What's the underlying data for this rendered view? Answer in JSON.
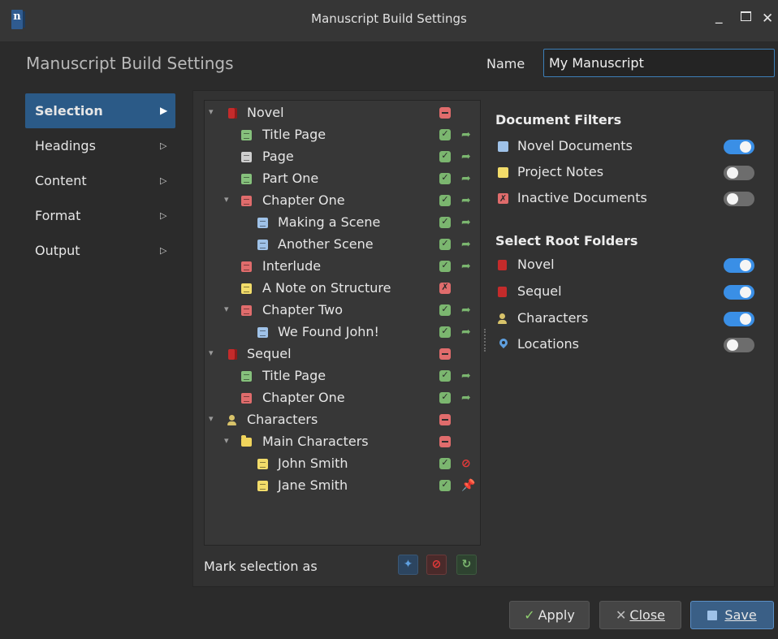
{
  "window": {
    "title": "Manuscript Build Settings",
    "app_icon_letter": "n",
    "minimize": "_",
    "close": "✕"
  },
  "header": {
    "title": "Manuscript Build Settings",
    "name_label": "Name",
    "name_value": "My Manuscript"
  },
  "nav": {
    "items": [
      {
        "label": "Selection",
        "active": true
      },
      {
        "label": "Headings",
        "active": false
      },
      {
        "label": "Content",
        "active": false
      },
      {
        "label": "Format",
        "active": false
      },
      {
        "label": "Output",
        "active": false
      }
    ]
  },
  "tree": [
    {
      "label": "Novel",
      "icon": "novel-root-icon",
      "expanded": true,
      "state": "partial"
    },
    {
      "label": "Title Page",
      "icon": "document-icon",
      "state": "included",
      "action": "go"
    },
    {
      "label": "Page",
      "icon": "document-icon",
      "state": "included",
      "action": "go"
    },
    {
      "label": "Part One",
      "icon": "document-icon",
      "state": "included",
      "action": "go"
    },
    {
      "label": "Chapter One",
      "icon": "document-icon",
      "expanded": true,
      "state": "included",
      "action": "go"
    },
    {
      "label": "Making a Scene",
      "icon": "document-icon",
      "state": "included",
      "action": "go"
    },
    {
      "label": "Another Scene",
      "icon": "document-icon",
      "state": "included",
      "action": "go"
    },
    {
      "label": "Interlude",
      "icon": "document-icon",
      "state": "included",
      "action": "go"
    },
    {
      "label": "A Note on Structure",
      "icon": "note-icon",
      "state": "excluded"
    },
    {
      "label": "Chapter Two",
      "icon": "document-icon",
      "expanded": true,
      "state": "included",
      "action": "go"
    },
    {
      "label": "We Found John!",
      "icon": "document-icon",
      "state": "included",
      "action": "go"
    },
    {
      "label": "Sequel",
      "icon": "novel-root-icon",
      "expanded": true,
      "state": "partial"
    },
    {
      "label": "Title Page",
      "icon": "document-icon",
      "state": "included",
      "action": "go"
    },
    {
      "label": "Chapter One",
      "icon": "document-icon",
      "state": "included",
      "action": "go"
    },
    {
      "label": "Characters",
      "icon": "person-icon",
      "expanded": true,
      "state": "partial"
    },
    {
      "label": "Main Characters",
      "icon": "folder-icon",
      "expanded": true,
      "state": "partial"
    },
    {
      "label": "John Smith",
      "icon": "note-icon",
      "state": "included",
      "action": "excluded"
    },
    {
      "label": "Jane Smith",
      "icon": "note-icon",
      "state": "included",
      "action": "pinned"
    }
  ],
  "mark_selection": {
    "label": "Mark selection as",
    "buttons": [
      "pin-icon",
      "exclude-icon",
      "reset-icon"
    ]
  },
  "document_filters": {
    "title": "Document Filters",
    "items": [
      {
        "label": "Novel Documents",
        "on": true
      },
      {
        "label": "Project Notes",
        "on": false
      },
      {
        "label": "Inactive Documents",
        "on": false
      }
    ]
  },
  "root_folders": {
    "title": "Select Root Folders",
    "items": [
      {
        "label": "Novel",
        "on": true
      },
      {
        "label": "Sequel",
        "on": true
      },
      {
        "label": "Characters",
        "on": true
      },
      {
        "label": "Locations",
        "on": false
      }
    ]
  },
  "buttons": {
    "apply": "Apply",
    "close": "Close",
    "save": "Save"
  },
  "colors": {
    "accent": "#3a8fe6",
    "nav_active": "#2b5a87",
    "include_green": "#7bb66f",
    "exclude_red": "#e83a3a",
    "pin_blue": "#5fa0e0"
  }
}
